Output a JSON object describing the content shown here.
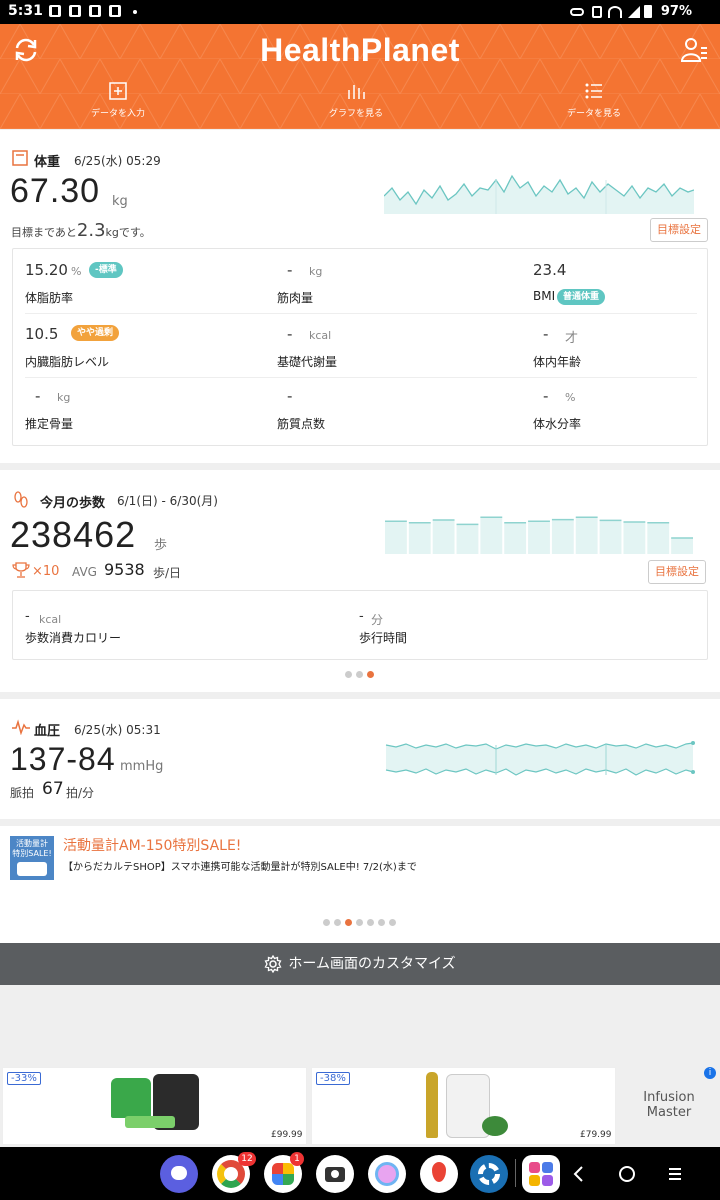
{
  "status_bar": {
    "time": "5:31",
    "dot": "•",
    "battery": "97%"
  },
  "header": {
    "logo": "HealthPlanet",
    "nav": [
      {
        "label": "データを入力"
      },
      {
        "label": "グラフを見る"
      },
      {
        "label": "データを見る"
      }
    ]
  },
  "weight": {
    "title": "体重",
    "date": "6/25(水) 05:29",
    "value": "67.30",
    "unit": "kg",
    "goal_prefix": "目標まであと",
    "goal_value": "2.3",
    "goal_suffix": "kgです。",
    "goal_button": "目標設定",
    "metrics": [
      {
        "value": "15.20",
        "unit": "%",
        "tag": "-標準",
        "label": "体脂肪率"
      },
      {
        "value": "-",
        "unit": "kg",
        "label": "筋肉量"
      },
      {
        "value": "23.4",
        "unit": "",
        "label": "BMI",
        "tag": "普通体重"
      },
      {
        "value": "10.5",
        "unit": "",
        "tag": "やや過剰",
        "label": "内臓脂肪レベル"
      },
      {
        "value": "-",
        "unit": "kcal",
        "label": "基礎代謝量"
      },
      {
        "value": "-",
        "unit": "才",
        "label": "体内年齢"
      },
      {
        "value": "-",
        "unit": "kg",
        "label": "推定骨量"
      },
      {
        "value": "-",
        "unit": "",
        "label": "筋質点数"
      },
      {
        "value": "-",
        "unit": "%",
        "label": "体水分率"
      }
    ]
  },
  "steps": {
    "title": "今月の歩数",
    "range": "6/1(日) - 6/30(月)",
    "value": "238462",
    "unit": "歩",
    "trophy": "×10",
    "avg_label": "AVG",
    "avg_value": "9538",
    "avg_unit": "歩/日",
    "goal_button": "目標設定",
    "calorie_value": "-",
    "calorie_unit": "kcal",
    "calorie_label": "歩数消費カロリー",
    "time_value": "-",
    "time_unit": "分",
    "time_label": "歩行時間",
    "bars": [
      0.82,
      0.78,
      0.85,
      0.74,
      0.92,
      0.78,
      0.82,
      0.86,
      0.92,
      0.84,
      0.8,
      0.78,
      0.4
    ]
  },
  "pressure": {
    "title": "血圧",
    "date": "6/25(水) 05:31",
    "value": "137-84",
    "unit": "mmHg",
    "pulse_label": "脈拍",
    "pulse_value": "67",
    "pulse_unit": "拍/分"
  },
  "promo": {
    "thumb_line1": "活動量計",
    "thumb_line2": "特別SALE!",
    "title": "活動量計AM-150特別SALE!",
    "text": "【からだカルテSHOP】スマホ連携可能な活動量計が特別SALE中! 7/2(水)まで"
  },
  "customize": {
    "label": "ホーム画面のカスタマイズ"
  },
  "ad": {
    "products": [
      {
        "discount": "-33%",
        "price": "£99.99"
      },
      {
        "discount": "-38%",
        "price": "£79.99"
      }
    ],
    "brand": "Infusion Master",
    "info": "i"
  },
  "dock": {
    "messages_badge": "12",
    "photos_badge": "1"
  },
  "colors": {
    "accent": "#f47432",
    "teal": "#5fc6c2",
    "warn": "#f2a23c",
    "customize_bar": "#5a5d60"
  }
}
